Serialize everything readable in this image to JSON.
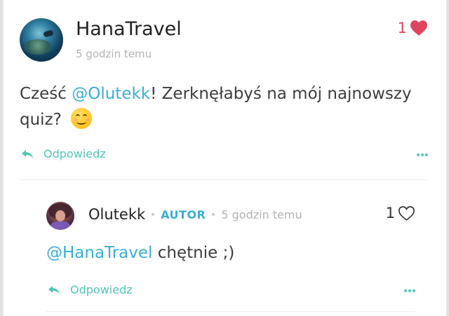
{
  "comment": {
    "author": "HanaTravel",
    "time": "5 godzin temu",
    "likes": "1",
    "liked": true,
    "message_before": "Cześć ",
    "mention": "@Olutekk",
    "message_after": "! Zerknęłabyś na mój najnowszy quiz?",
    "emoji": "smiling-face-emoji",
    "reply_label": "Odpowiedz"
  },
  "reply": {
    "author": "Olutekk",
    "badge": "AUTOR",
    "time": "5 godzin temu",
    "likes": "1",
    "liked": false,
    "mention": "@HanaTravel",
    "message": " chętnie ;)",
    "reply_label": "Odpowiedz"
  },
  "colors": {
    "accent_teal": "#4fc7b6",
    "mention_blue": "#3aaed8",
    "heart_red": "#e0455e",
    "muted": "#b3b3b3"
  }
}
